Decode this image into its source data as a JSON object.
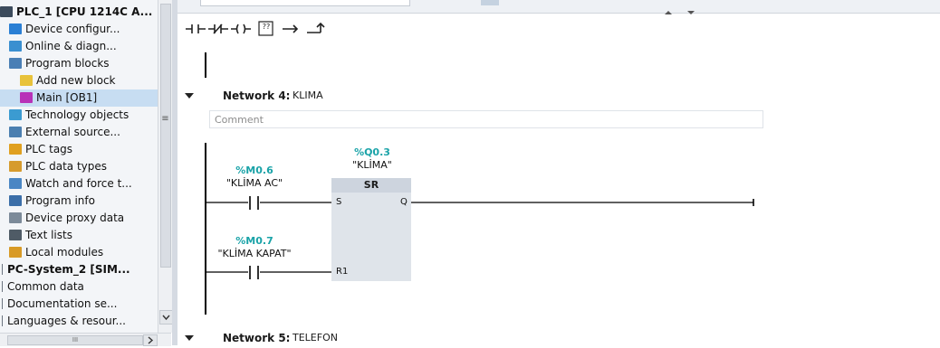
{
  "project_tree": {
    "items": [
      {
        "label": "PLC_1 [CPU 1214C A...",
        "icon": "plc-station-icon",
        "color": "#3c4b5c"
      },
      {
        "label": "Device configur...",
        "icon": "device-config-icon",
        "color": "#2a7fd4"
      },
      {
        "label": "Online & diagn...",
        "icon": "online-diag-icon",
        "color": "#3a8fd0"
      },
      {
        "label": "Program blocks",
        "icon": "program-blocks-folder-icon",
        "color": "#4a7fb5"
      },
      {
        "label": "Add new block",
        "icon": "add-block-icon",
        "color": "#e8c23a"
      },
      {
        "label": "Main [OB1]",
        "icon": "ob-block-icon",
        "color": "#b832b8"
      },
      {
        "label": "Technology objects",
        "icon": "technology-objects-icon",
        "color": "#3b9bd1"
      },
      {
        "label": "External source...",
        "icon": "external-source-icon",
        "color": "#4b7fb0"
      },
      {
        "label": "PLC tags",
        "icon": "plc-tags-icon",
        "color": "#e0a020"
      },
      {
        "label": "PLC data types",
        "icon": "plc-datatypes-icon",
        "color": "#d69b2e"
      },
      {
        "label": "Watch and force t...",
        "icon": "watch-force-icon",
        "color": "#4a86c4"
      },
      {
        "label": "Program info",
        "icon": "program-info-icon",
        "color": "#3b6ea8"
      },
      {
        "label": "Device proxy data",
        "icon": "device-proxy-icon",
        "color": "#7c8a99"
      },
      {
        "label": "Text lists",
        "icon": "text-lists-icon",
        "color": "#4f5b66"
      },
      {
        "label": "Local modules",
        "icon": "local-modules-icon",
        "color": "#d89a26"
      },
      {
        "label": "PC-System_2 [SIM...",
        "icon": "",
        "color": ""
      },
      {
        "label": "Common data",
        "icon": "",
        "color": ""
      },
      {
        "label": "Documentation se...",
        "icon": "",
        "color": ""
      },
      {
        "label": "Languages & resour...",
        "icon": "",
        "color": ""
      }
    ],
    "selected_index": 5,
    "scroll_grip": "≡",
    "hscroll_grip": "III"
  },
  "toolbar": {
    "buttons": [
      "normally-open-contact",
      "normally-closed-contact",
      "coil",
      "empty-box",
      "open-branch",
      "close-branch"
    ],
    "empty_box_label": "??"
  },
  "network4": {
    "title": "Network 4:",
    "name": "KLIMA",
    "comment_placeholder": "Comment",
    "contact1": {
      "address": "%M0.6",
      "symbol": "\"KLİMA AC\""
    },
    "contact2": {
      "address": "%M0.7",
      "symbol": "\"KLİMA KAPAT\""
    },
    "sr": {
      "address": "%Q0.3",
      "symbol": "\"KLİMA\"",
      "title": "SR",
      "pin_s": "S",
      "pin_q": "Q",
      "pin_r1": "R1"
    }
  },
  "network5": {
    "title": "Network 5:",
    "name": "TELEFON"
  },
  "colors": {
    "address": "#1aa3a8",
    "selection": "#c7ddf2",
    "sr_box": "#dfe4ea"
  }
}
